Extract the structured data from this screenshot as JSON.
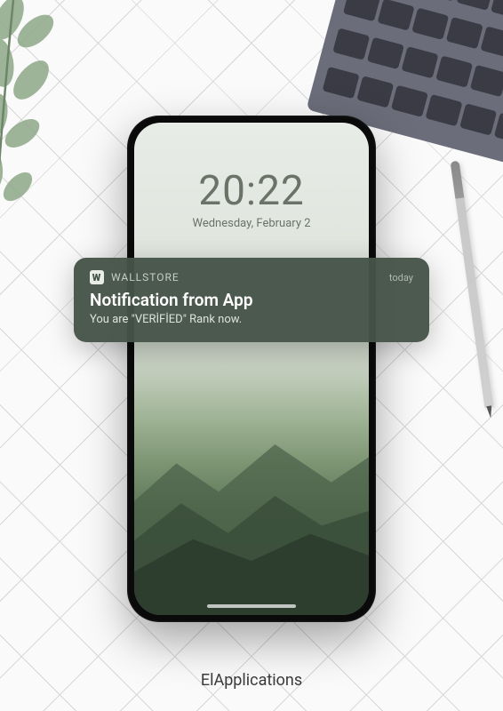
{
  "lockscreen": {
    "time": "20:22",
    "date": "Wednesday, February 2"
  },
  "notification": {
    "app_icon_letter": "W",
    "app_name": "WALLSTORE",
    "timestamp": "today",
    "title": "Notification from App",
    "body": "You are  \"VERİFİED\" Rank now."
  },
  "brand": "ElApplications"
}
